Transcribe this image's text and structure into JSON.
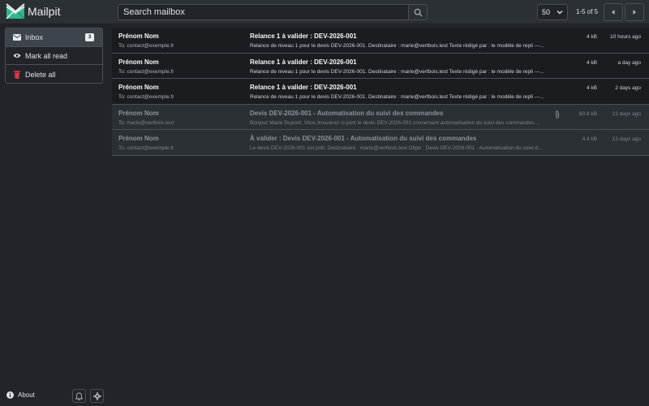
{
  "app": {
    "name": "Mailpit"
  },
  "search": {
    "placeholder": "Search mailbox",
    "value": ""
  },
  "pagination": {
    "per_page": "50",
    "range": "1-5 of 5"
  },
  "sidebar": {
    "items": [
      {
        "label": "Inbox",
        "badge": "3",
        "icon": "envelope-icon",
        "active": true
      },
      {
        "label": "Mark all read",
        "icon": "eye-icon"
      },
      {
        "label": "Delete all",
        "icon": "trash-icon"
      }
    ]
  },
  "messages": [
    {
      "from": "Prénom Nom",
      "to": "To: contact@exemple.fr",
      "subject": "Relance 1 à valider : DEV-2026-001",
      "snippet": "Relance de niveau 1 pour le devis DEV-2026-001. Destinataire : marie@vertbois.test Texte rédigé par : le modèle de repli ---...",
      "size": "4 kB",
      "time": "10 hours ago",
      "unread": true,
      "attachment": false
    },
    {
      "from": "Prénom Nom",
      "to": "To: contact@exemple.fr",
      "subject": "Relance 1 à valider : DEV-2026-001",
      "snippet": "Relance de niveau 1 pour le devis DEV-2026-001. Destinataire : marie@vertbois.test Texte rédigé par : le modèle de repli ---...",
      "size": "4 kB",
      "time": "a day ago",
      "unread": true,
      "attachment": false
    },
    {
      "from": "Prénom Nom",
      "to": "To: contact@exemple.fr",
      "subject": "Relance 1 à valider : DEV-2026-001",
      "snippet": "Relance de niveau 1 pour le devis DEV-2026-001. Destinataire : marie@vertbois.test Texte rédigé par : le modèle de repli ---...",
      "size": "4 kB",
      "time": "2 days ago",
      "unread": true,
      "attachment": false
    },
    {
      "from": "Prénom Nom",
      "to": "To: marie@vertbois.test",
      "subject": "Devis DEV-2026-001 - Automatisation du suivi des commandes",
      "snippet": "Bonjour Marie Dupont, Vous trouverez ci-joint le devis DEV-2026-001 concernant automatisation du suivi des commandes....",
      "size": "60.8 kB",
      "time": "13 days ago",
      "unread": false,
      "attachment": true
    },
    {
      "from": "Prénom Nom",
      "to": "To: contact@exemple.fr",
      "subject": "À valider : Devis DEV-2026-001 - Automatisation du suivi des commandes",
      "snippet": "Le devis DEV-2026-001 est prêt. Destinataire : marie@vertbois.test Objet : Devis DEV-2026-001 - Automatisation du suivi d...",
      "size": "4.4 kB",
      "time": "13 days ago",
      "unread": false,
      "attachment": false
    }
  ],
  "footer": {
    "about_label": "About"
  },
  "colors": {
    "background": "#212529",
    "topbar": "#2b3035",
    "unread_row": "#1a1d20",
    "read_row": "#2b3035",
    "logo_green": "#2db98c"
  }
}
